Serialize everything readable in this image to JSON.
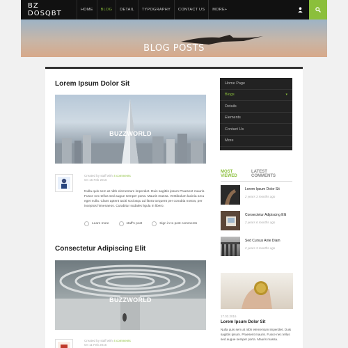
{
  "brand": {
    "logo": "BZ DOSQBT",
    "accent": "#8bbf3b"
  },
  "nav": {
    "items": [
      {
        "label": "HOME",
        "active": false
      },
      {
        "label": "BLOG",
        "active": true
      },
      {
        "label": "DETAIL",
        "active": false
      },
      {
        "label": "TYPOGRAPHY",
        "active": false
      },
      {
        "label": "CONTACT US",
        "active": false
      },
      {
        "label": "MORE+",
        "active": false
      }
    ]
  },
  "hero": {
    "title": "BLOG POSTS"
  },
  "posts": [
    {
      "title": "Lorem Ipsum Dolor Sit",
      "image_label": "BUZZWORLD",
      "meta_by": "Created by staff with",
      "meta_comments": "4 comments",
      "meta_date": "On 15 Feb 2016",
      "excerpt": "Nulla quis sem at nibh elementum imperdiet. Duis sagittis ipsum Praesent mauris. Fusce nec tellus sed augue semper porta. Mauris massa. Vestibulum lacinia arcu eget nulla. Class aptent taciti sociosqu ad litora torquent per conubia nostra, per inceptos himenaeos. Curabitur sodales ligula in libero.",
      "links": [
        "Learn more",
        "staff's post",
        "Sign in to post comments"
      ]
    },
    {
      "title": "Consectetur Adipiscing Elit",
      "image_label": "BUZZWORLD",
      "meta_by": "Created by staff with",
      "meta_comments": "4 comments",
      "meta_date": "On 11 Feb 2016"
    }
  ],
  "sidebar": {
    "menu": [
      {
        "label": "Home Page",
        "active": false
      },
      {
        "label": "Blogs",
        "active": true
      },
      {
        "label": "Details",
        "active": false
      },
      {
        "label": "Elements",
        "active": false
      },
      {
        "label": "Contact Us",
        "active": false
      },
      {
        "label": "More",
        "active": false
      }
    ],
    "tabs": [
      "MOST VIEWED",
      "LATEST COMMENTS"
    ],
    "recent": [
      {
        "title": "Lorem Ipsum Dolor Sit",
        "date": "2 years 3 months ago"
      },
      {
        "title": "Consectetur Adipiscing Elit",
        "date": "2 years 6 months ago"
      },
      {
        "title": "Sed Cursus Ante Diam",
        "date": "2 years 3 months ago"
      }
    ],
    "featured": {
      "date": "17.03.2016",
      "title": "Lorem Ipsum Dolor Sit",
      "text": "Nulla quis sem at nibh elementum imperdiet. Duis sagittis ipsum. Praesent mauris. Fusce nec tellus sed augue semper porta. Mauris massa."
    }
  }
}
